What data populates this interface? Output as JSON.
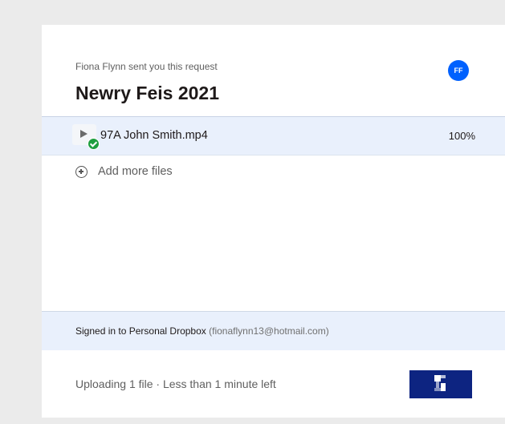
{
  "request": {
    "requester_text": "Fiona Flynn sent you this request",
    "avatar_initials": "FF",
    "title": "Newry Feis 2021"
  },
  "files": [
    {
      "name": "97A John Smith.mp4",
      "progress": "100%",
      "status": "uploaded",
      "icon": "play-icon"
    }
  ],
  "add_files": {
    "label": "Add more files",
    "icon": "add-circle-icon"
  },
  "account": {
    "prefix": "Signed in to Personal Dropbox",
    "email": "(fionaflynn13@hotmail.com)"
  },
  "footer": {
    "status": "Uploading 1 file · Less than 1 minute left",
    "button_icon": "spinner-icon"
  },
  "colors": {
    "accent": "#0061fe",
    "highlight_bg": "#e9f0fc",
    "button_bg": "#0d2481",
    "success": "#1e9e3e"
  }
}
